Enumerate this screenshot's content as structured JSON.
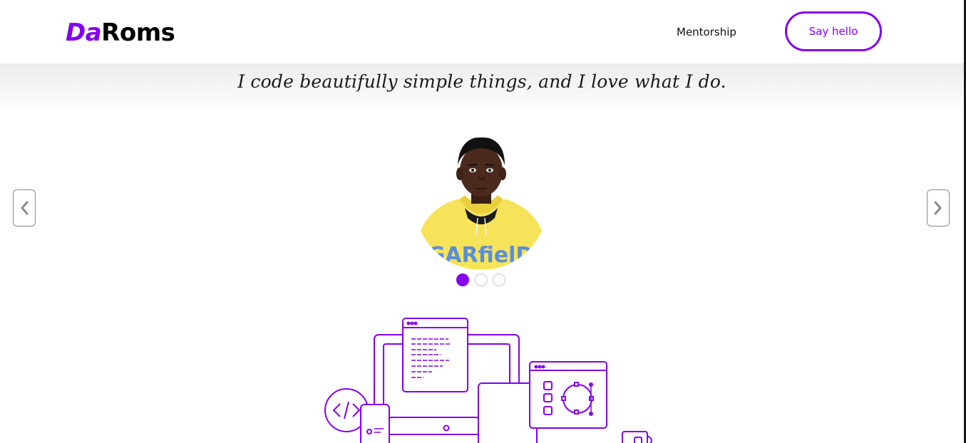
{
  "header": {
    "logo_accent": "Da",
    "logo_rest": "Roms",
    "nav_link": "Mentorship",
    "cta_label": "Say hello"
  },
  "hero": {
    "tagline": "I code beautifully simple things, and I love what I do.",
    "hoodie_text": "GARfielD",
    "carousel": {
      "prev_icon": "chevron-left-icon",
      "next_icon": "chevron-right-icon",
      "slide_count": 3,
      "active_index": 0
    }
  },
  "colors": {
    "brand": "#8400f0",
    "text": "#111111",
    "hoodie": "#f7e35a",
    "hoodie_print": "#5a8fd8"
  }
}
